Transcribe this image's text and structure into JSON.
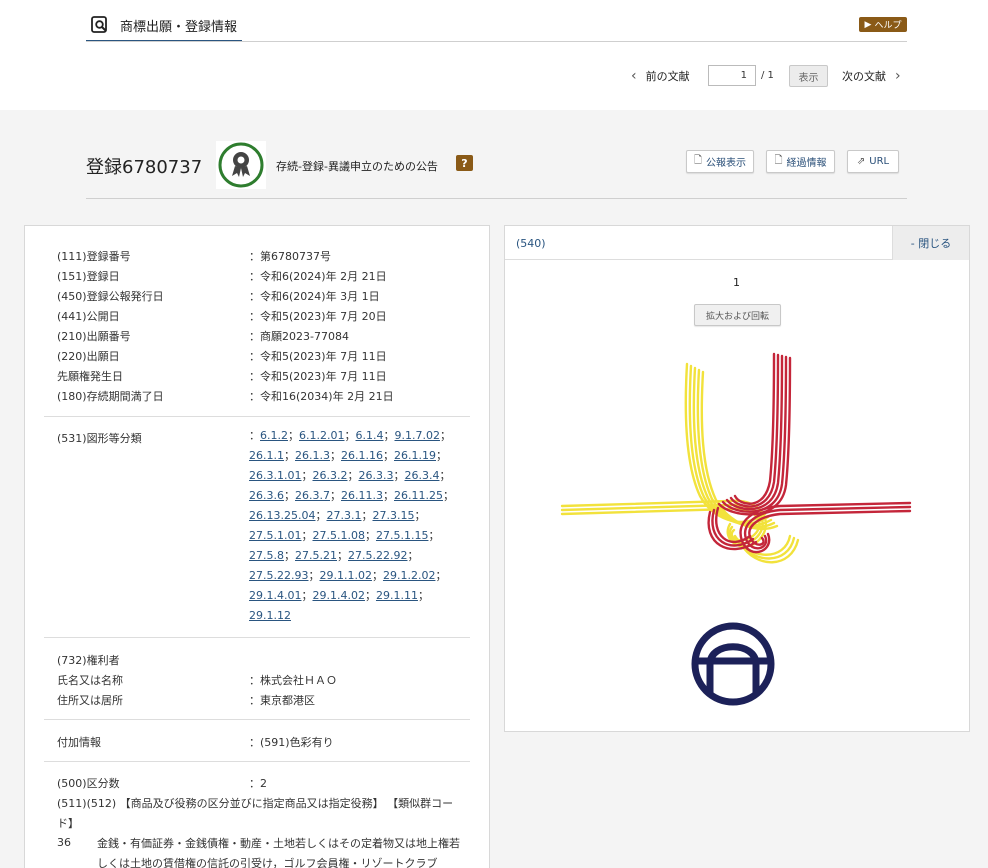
{
  "header": {
    "tab_label": "商標出願・登録情報",
    "help_label": "ヘルプ",
    "prev_label": "前の文献",
    "next_label": "次の文献",
    "page_value": "1",
    "page_total": "/ 1",
    "show_label": "表示"
  },
  "record": {
    "title": "登録6780737",
    "status": "存続-登録-異議申立のための公告",
    "help_q": "?",
    "buttons": {
      "gazette": "公報表示",
      "history": "経過情報",
      "url": "URL"
    }
  },
  "details": [
    {
      "label": "(111)登録番号",
      "value": "：第6780737号"
    },
    {
      "label": "(151)登録日",
      "value": "：令和6(2024)年 2月 21日"
    },
    {
      "label": "(450)登録公報発行日",
      "value": "：令和6(2024)年 3月 1日"
    },
    {
      "label": "(441)公開日",
      "value": "：令和5(2023)年 7月 20日"
    },
    {
      "label": "(210)出願番号",
      "value": "：商願2023-77084"
    },
    {
      "label": "(220)出願日",
      "value": "：令和5(2023)年 7月 11日"
    },
    {
      "label": "先願権発生日",
      "value": "：令和5(2023)年 7月 11日"
    },
    {
      "label": "(180)存続期間満了日",
      "value": "：令和16(2034)年 2月 21日"
    }
  ],
  "figure_class": {
    "label": "(531)図形等分類",
    "codes": [
      "6.1.2",
      "6.1.2.01",
      "6.1.4",
      "9.1.7.02",
      "26.1.1",
      "26.1.3",
      "26.1.16",
      "26.1.19",
      "26.3.1.01",
      "26.3.2",
      "26.3.3",
      "26.3.4",
      "26.3.6",
      "26.3.7",
      "26.11.3",
      "26.11.25",
      "26.13.25.04",
      "27.3.1",
      "27.3.15",
      "27.5.1.01",
      "27.5.1.08",
      "27.5.1.15",
      "27.5.8",
      "27.5.21",
      "27.5.22.92",
      "27.5.22.93",
      "29.1.1.02",
      "29.1.2.02",
      "29.1.4.01",
      "29.1.4.02",
      "29.1.11",
      "29.1.12"
    ]
  },
  "owner": {
    "label": "(732)権利者",
    "name_label": "氏名又は名称",
    "name_value": "：株式会社ＨＡＯ",
    "addr_label": "住所又は居所",
    "addr_value": "：東京都港区"
  },
  "extra": {
    "label": "付加情報",
    "value": "：(591)色彩有り"
  },
  "classes": {
    "count_label": "(500)区分数",
    "count_value": "：2",
    "heading": "(511)(512) 【商品及び役務の区分並びに指定商品又は指定役務】 【類似群コード】",
    "class_num": "36",
    "class_text": "金銭・有価証券・金銭債権・動産・土地若しくはその定着物又は地上権若しくは土地の賃借権の信託の引受け，ゴルフ会員権・リゾートクラブ"
  },
  "image_panel": {
    "label": "(540)",
    "close_label": "- 閉じる",
    "image_number": "1",
    "zoom_label": "拡大および回転"
  },
  "colors": {
    "red": "#c4263a",
    "yellow": "#f2e23c",
    "navy": "#1c2159",
    "link": "#2a5580",
    "help": "#8a5a17"
  }
}
